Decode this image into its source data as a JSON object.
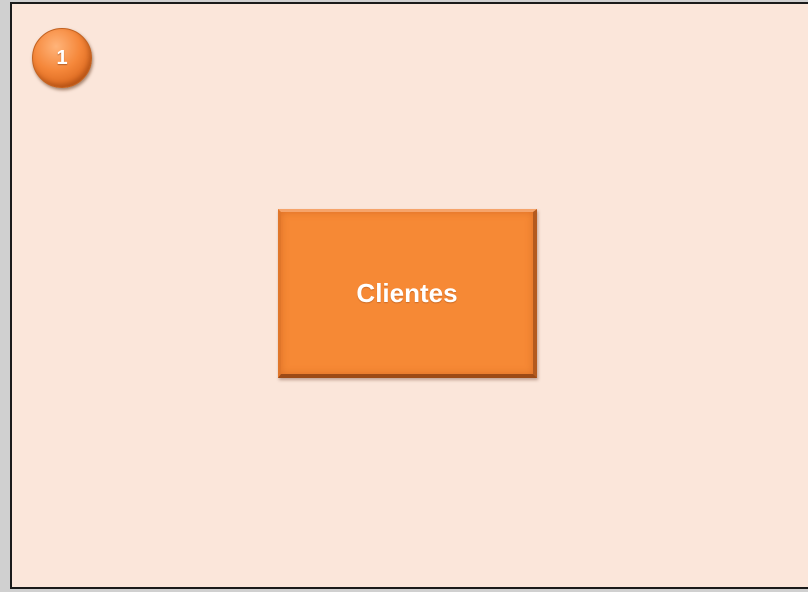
{
  "slide": {
    "step_number": "1",
    "button_label": "Clientes"
  },
  "colors": {
    "background": "#fbe6da",
    "accent": "#f68935",
    "border": "#1a1a1a",
    "text": "#ffffff"
  }
}
